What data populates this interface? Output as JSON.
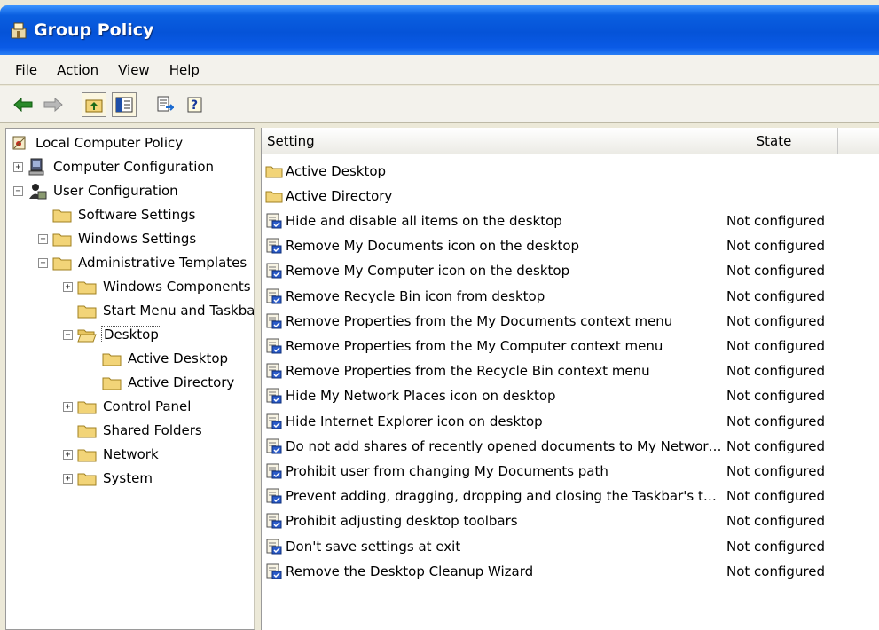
{
  "window": {
    "title": "Group Policy"
  },
  "menu": [
    "File",
    "Action",
    "View",
    "Help"
  ],
  "toolbar": {
    "buttons": [
      "back-arrow-icon",
      "forward-arrow-icon",
      "up-folder-icon",
      "show-hide-tree-icon",
      "export-list-icon",
      "help-icon"
    ]
  },
  "tree": {
    "root": "Local Computer Policy",
    "computer_configuration": "Computer Configuration",
    "user_configuration": "User Configuration",
    "software_settings": "Software Settings",
    "windows_settings": "Windows Settings",
    "administrative_templates": "Administrative Templates",
    "windows_components": "Windows Components",
    "start_menu": "Start Menu and Taskbai",
    "desktop": "Desktop",
    "active_desktop": "Active Desktop",
    "active_directory": "Active Directory",
    "control_panel": "Control Panel",
    "shared_folders": "Shared Folders",
    "network": "Network",
    "system": "System"
  },
  "list": {
    "columns": {
      "setting": "Setting",
      "state": "State"
    },
    "folders": [
      "Active Desktop",
      "Active Directory"
    ],
    "settings": [
      {
        "name": "Hide and disable all items on the desktop",
        "state": "Not configured"
      },
      {
        "name": "Remove My Documents icon on the desktop",
        "state": "Not configured"
      },
      {
        "name": "Remove My Computer icon on the desktop",
        "state": "Not configured"
      },
      {
        "name": "Remove Recycle Bin icon from desktop",
        "state": "Not configured"
      },
      {
        "name": "Remove Properties from the My Documents context menu",
        "state": "Not configured"
      },
      {
        "name": "Remove Properties from the My Computer context menu",
        "state": "Not configured"
      },
      {
        "name": "Remove Properties from the Recycle Bin context menu",
        "state": "Not configured"
      },
      {
        "name": "Hide My Network Places icon on desktop",
        "state": "Not configured"
      },
      {
        "name": "Hide Internet Explorer icon on desktop",
        "state": "Not configured"
      },
      {
        "name": "Do not add shares of recently opened documents to My Network ...",
        "state": "Not configured"
      },
      {
        "name": "Prohibit user from changing My Documents path",
        "state": "Not configured"
      },
      {
        "name": "Prevent adding, dragging, dropping and closing the Taskbar's tool...",
        "state": "Not configured"
      },
      {
        "name": "Prohibit adjusting desktop toolbars",
        "state": "Not configured"
      },
      {
        "name": "Don't save settings at exit",
        "state": "Not configured"
      },
      {
        "name": "Remove the Desktop Cleanup Wizard",
        "state": "Not configured"
      }
    ]
  },
  "colors": {
    "titlebar": "#0553d8",
    "folder": "#f2d478",
    "selection_text": "#000000"
  }
}
